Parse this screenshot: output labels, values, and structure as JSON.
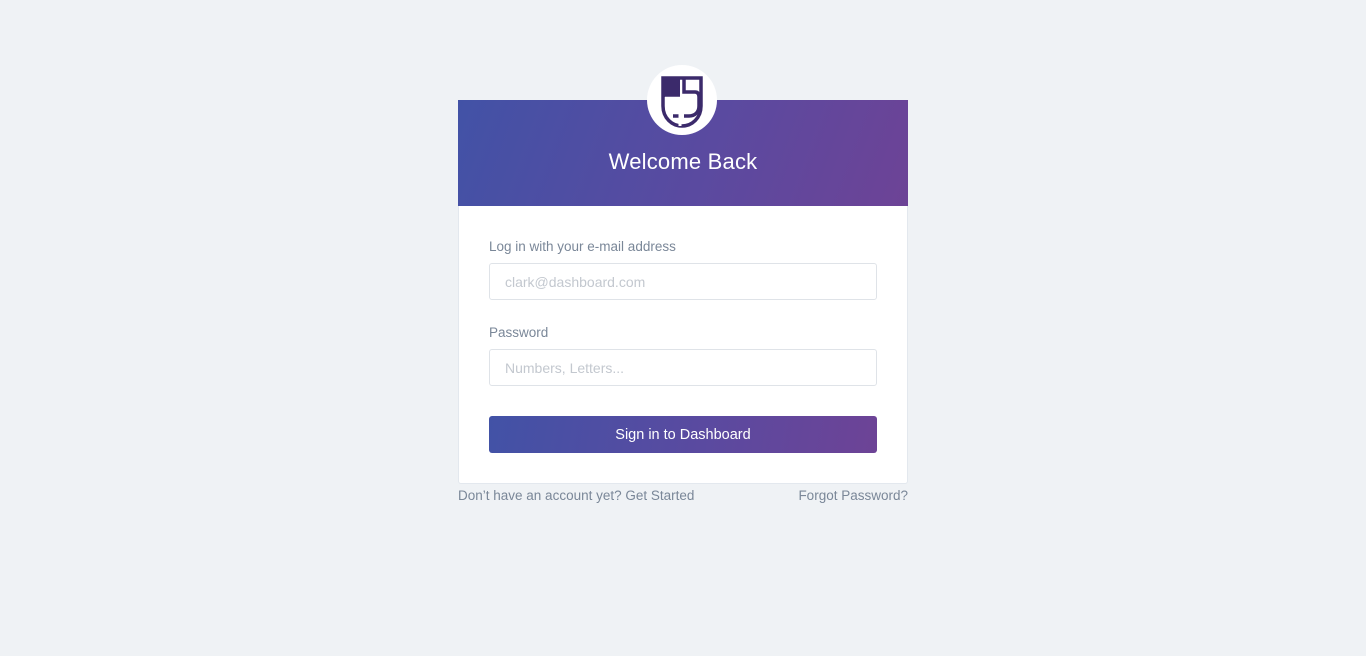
{
  "brand": {
    "logo_icon": "shield-logo-icon",
    "logo_color": "#3b2a6b"
  },
  "header": {
    "title": "Welcome Back",
    "gradient_start": "#4252a6",
    "gradient_end": "#6d4396"
  },
  "form": {
    "email": {
      "label": "Log in with your e-mail address",
      "placeholder": "clark@dashboard.com",
      "value": ""
    },
    "password": {
      "label": "Password",
      "placeholder": "Numbers, Letters...",
      "value": ""
    },
    "submit_label": "Sign in to Dashboard"
  },
  "footer": {
    "signup_text": "Don’t have an account yet? Get Started",
    "forgot_text": "Forgot Password?"
  }
}
